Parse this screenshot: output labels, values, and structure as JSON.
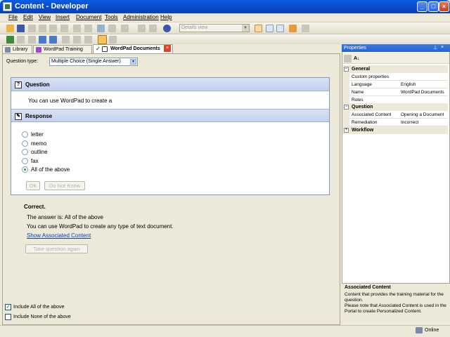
{
  "window": {
    "title": "Content - Developer"
  },
  "menu": [
    "File",
    "Edit",
    "View",
    "Insert",
    "Document",
    "Tools",
    "Administration",
    "Help"
  ],
  "toolbar": {
    "view_select": "Details view"
  },
  "tabs": [
    {
      "label": "Library",
      "icon": "library-icon"
    },
    {
      "label": "WordPad Training",
      "icon": "module-icon"
    },
    {
      "label": "WordPad Documents",
      "icon": "question-icon",
      "active": true
    }
  ],
  "question_type": {
    "label": "Question type:",
    "value": "Multiple Choice (Single Answer)"
  },
  "question": {
    "heading": "Question",
    "text": "You can use WordPad to create a"
  },
  "response": {
    "heading": "Response",
    "options": [
      {
        "label": "letter",
        "selected": false
      },
      {
        "label": "memo",
        "selected": false
      },
      {
        "label": "outline",
        "selected": false
      },
      {
        "label": "fax",
        "selected": false
      },
      {
        "label": "All of the above",
        "selected": true
      }
    ],
    "ok_label": "OK",
    "dont_know_label": "Do Not Know"
  },
  "feedback": {
    "status": "Correct.",
    "answer": "The answer is: All of the above",
    "explanation": "You can use WordPad to create any type of text document.",
    "link": "Show Associated Content",
    "retake": "Take question again"
  },
  "options_checkboxes": [
    {
      "label": "Include All of the above",
      "checked": true
    },
    {
      "label": "Include None of the above",
      "checked": false
    }
  ],
  "properties": {
    "title": "Properties",
    "categories": [
      {
        "name": "General",
        "expanded": true,
        "rows": [
          {
            "key": "Custom properties",
            "value": ""
          },
          {
            "key": "Language",
            "value": "English"
          },
          {
            "key": "Name",
            "value": "WordPad Documents"
          },
          {
            "key": "Roles",
            "value": ""
          }
        ]
      },
      {
        "name": "Question",
        "expanded": true,
        "rows": [
          {
            "key": "Associated Content",
            "value": "Opening a Document"
          },
          {
            "key": "Remediation",
            "value": "Incorrect"
          }
        ]
      },
      {
        "name": "Workflow",
        "expanded": false,
        "rows": []
      }
    ],
    "description_title": "Associated Content",
    "description_text": "Content that provides the training material for the question.\nPlease note that Associated Content is used in the Portal to create Personalized Content."
  },
  "status": {
    "text": "Online"
  }
}
